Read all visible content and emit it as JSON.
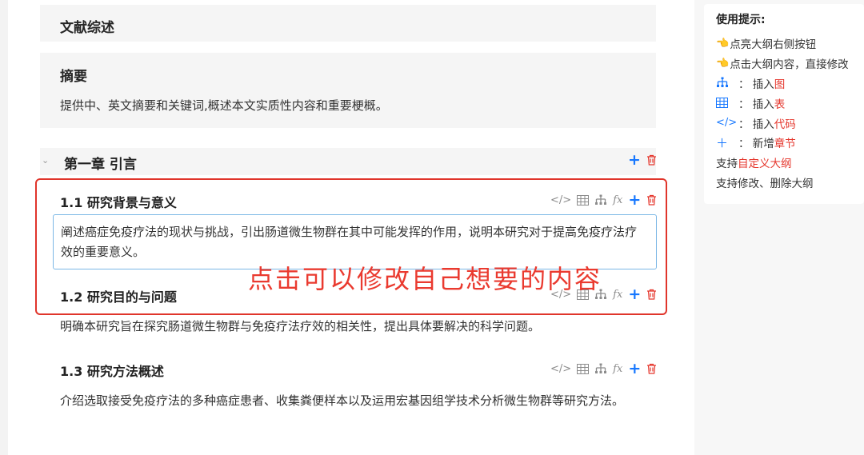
{
  "cards": {
    "review": {
      "title": "文献综述"
    },
    "abstract": {
      "title": "摘要",
      "desc": "提供中、英文摘要和关键词,概述本文实质性内容和重要梗概。"
    }
  },
  "chapter": {
    "collapse_glyph": "⌄",
    "title": "第一章 引言"
  },
  "sections": [
    {
      "title": "1.1 研究背景与意义",
      "desc": "阐述癌症免疫疗法的现状与挑战，引出肠道微生物群在其中可能发挥的作用，说明本研究对于提高免疫疗法疗效的重要意义。"
    },
    {
      "title": "1.2 研究目的与问题",
      "desc": "明确本研究旨在探究肠道微生物群与免疫疗法疗效的相关性，提出具体要解决的科学问题。"
    },
    {
      "title": "1.3 研究方法概述",
      "desc": "介绍选取接受免疫疗法的多种癌症患者、收集粪便样本以及运用宏基因组学技术分析微生物群等研究方法。"
    }
  ],
  "toolbar": {
    "code": "</>",
    "fx": "fx",
    "plus": "+"
  },
  "overlay": {
    "text": "点击可以修改自己想要的内容"
  },
  "tips": {
    "title": "使用提示:",
    "emoji": "👈",
    "light_up": "点亮大纲右侧按钮",
    "click_edit": "点击大纲内容，直接修改",
    "insert_figure": {
      "prefix": "：  插入",
      "highlight": "图"
    },
    "insert_table": {
      "prefix": "：  插入",
      "highlight": "表"
    },
    "insert_code": {
      "icon": "</>",
      "prefix": "：  插入",
      "highlight": "代码"
    },
    "add_chapter": {
      "icon": "＋",
      "prefix": "：  新增",
      "highlight": "章节"
    },
    "custom_outline": {
      "prefix": "支持",
      "highlight": "自定义大纲"
    },
    "edit_delete": "支持修改、删除大纲"
  },
  "colors": {
    "accent_blue": "#1677ff",
    "danger_red": "#e5362c",
    "annotation_red": "#ea3a2f",
    "card_gray": "#f5f5f5"
  }
}
